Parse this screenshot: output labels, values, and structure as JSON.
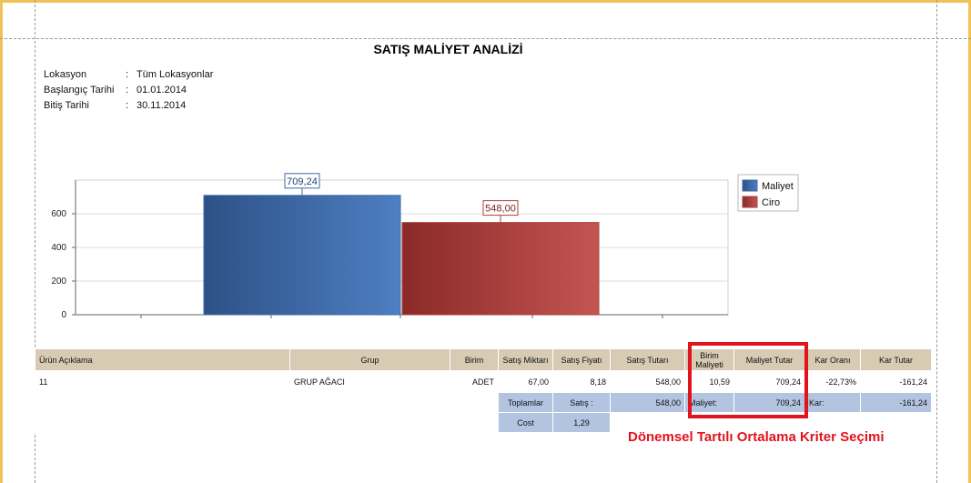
{
  "report": {
    "title": "SATIŞ MALİYET ANALİZİ",
    "meta": [
      {
        "label": "Lokasyon",
        "value": "Tüm Lokasyonlar"
      },
      {
        "label": "Başlangıç Tarihi",
        "value": "01.01.2014"
      },
      {
        "label": "Bitiş Tarihi",
        "value": "30.11.2014"
      }
    ],
    "colon": ":"
  },
  "chart_data": {
    "type": "bar",
    "categories": [
      ""
    ],
    "series": [
      {
        "name": "Maliyet",
        "values": [
          709.24
        ],
        "label": "709,24",
        "color": "#3f6aa6"
      },
      {
        "name": "Ciro",
        "values": [
          548.0
        ],
        "label": "548,00",
        "color": "#a8403d"
      }
    ],
    "yticks": [
      "0",
      "200",
      "400",
      "600"
    ],
    "ylim": [
      0,
      800
    ],
    "grid": true,
    "legend": "right"
  },
  "table": {
    "headers": {
      "urun": "Ürün Açıklama",
      "grup": "Grup",
      "birim": "Birim",
      "miktar": "Satış Miktarı",
      "fiyat": "Satış Fiyatı",
      "tutar": "Satış Tutarı",
      "birim_maliyet_1": "Birim",
      "birim_maliyet_2": "Maliyeti",
      "maliyet_tutar": "Maliyet Tutar",
      "kar_orani": "Kar Oranı",
      "kar_tutar": "Kar Tutar"
    },
    "row": {
      "urun": "11",
      "grup": "GRUP AĞACI",
      "birim": "ADET",
      "miktar": "67,00",
      "fiyat": "8,18",
      "tutar": "548,00",
      "birim_maliyet": "10,59",
      "maliyet_tutar": "709,24",
      "kar_orani": "-22,73%",
      "kar_tutar": "-161,24"
    },
    "totals": {
      "label": "Toplamlar",
      "satis_label": "Satış :",
      "satis": "548,00",
      "maliyet_label": "Maliyet:",
      "maliyet": "709,24",
      "kar_label": "Kar:",
      "kar": "-161,24",
      "cost_label": "Cost",
      "cost": "1,29"
    }
  },
  "annotation": "Dönemsel Tartılı Ortalama Kriter Seçimi"
}
